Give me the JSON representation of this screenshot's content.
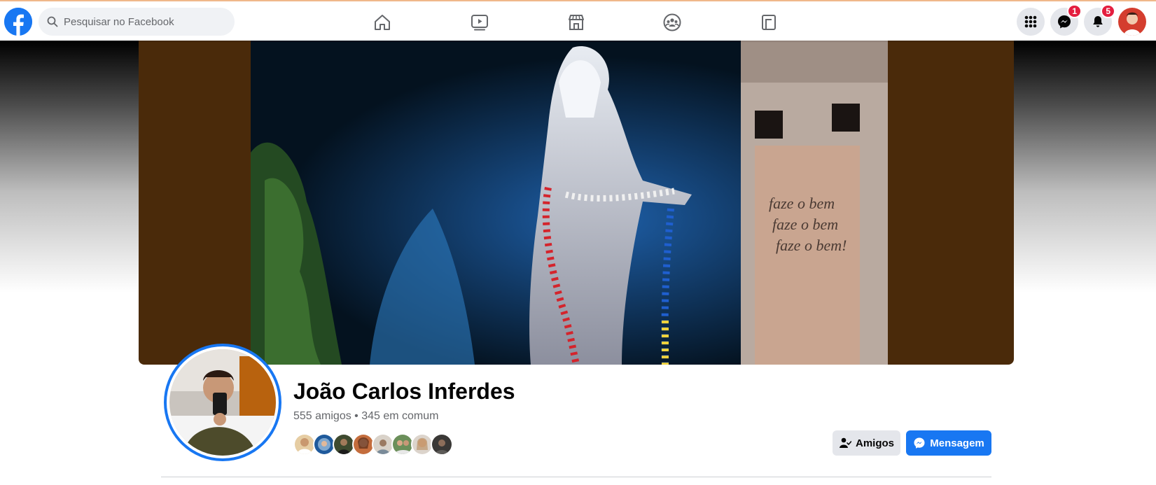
{
  "header": {
    "search_placeholder": "Pesquisar no Facebook",
    "nav": [
      "home-icon",
      "watch-icon",
      "marketplace-icon",
      "groups-icon",
      "gaming-icon"
    ],
    "menu_icon": "grid-menu-icon",
    "messenger_badge": "1",
    "notifications_badge": "5"
  },
  "cover": {
    "description_icon": "cover-photo"
  },
  "profile": {
    "name": "João Carlos Inferdes",
    "friends_summary": "555 amigos • 345 em comum"
  },
  "actions": {
    "friends_label": "Amigos",
    "message_label": "Mensagem"
  },
  "colors": {
    "brand": "#1877f2",
    "badge": "#e41e3f",
    "secondary_button": "#e4e6eb"
  }
}
